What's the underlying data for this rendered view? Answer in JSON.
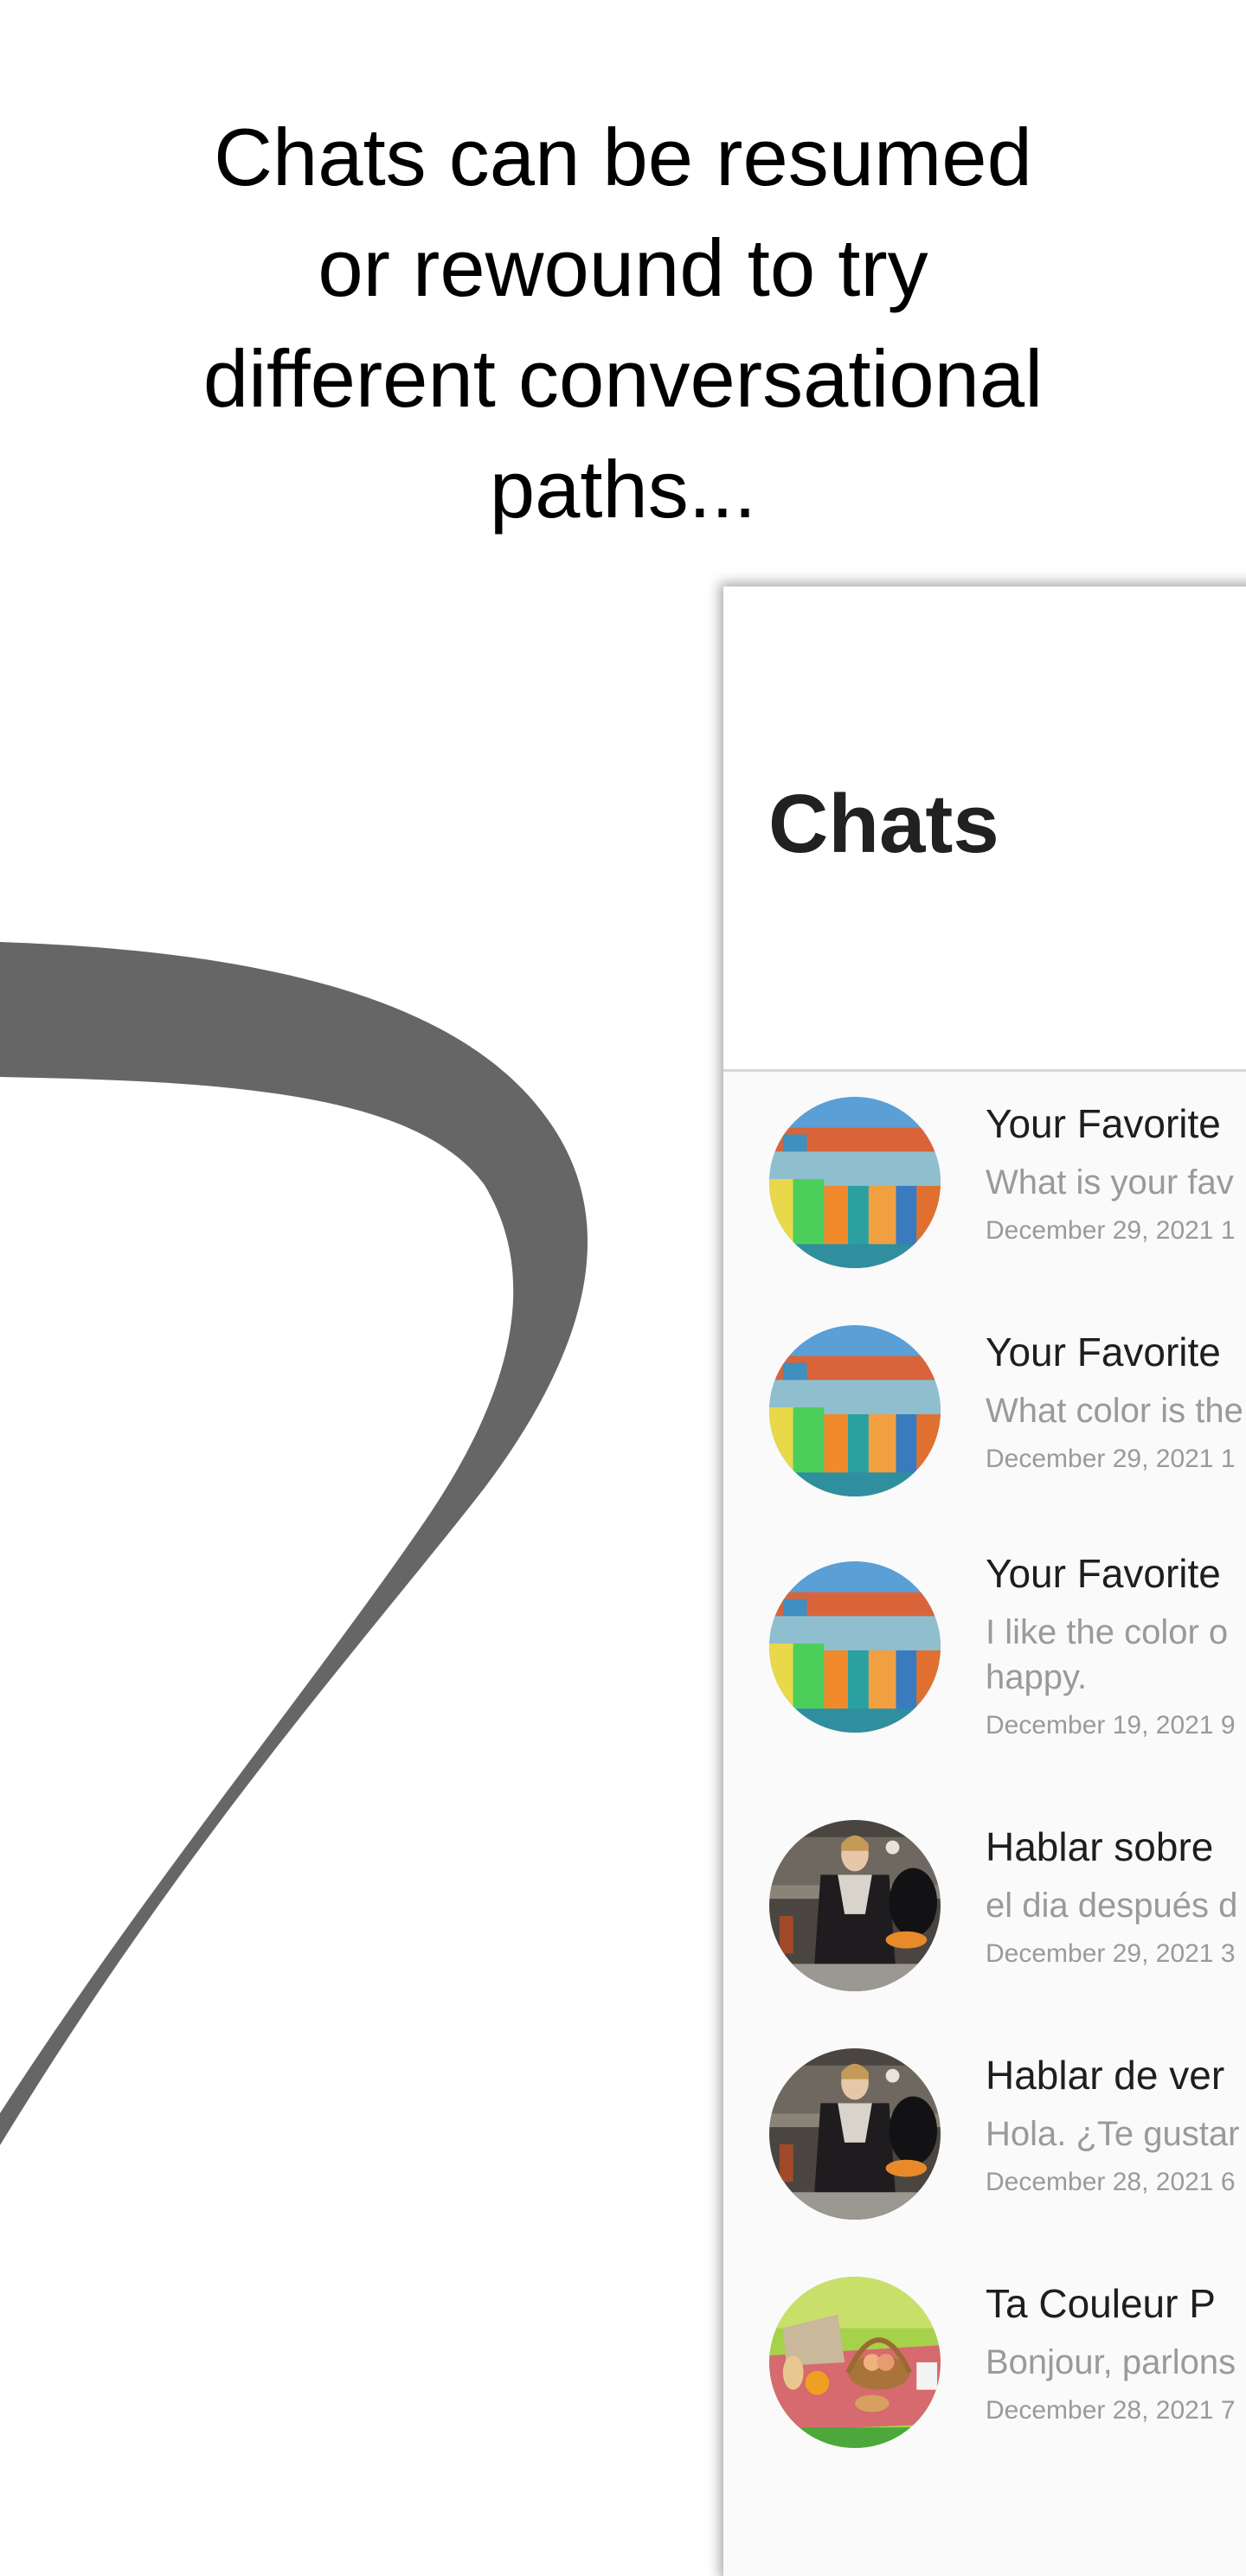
{
  "headline": {
    "lines": [
      "Chats can be resumed",
      "or rewound to try",
      "different conversational",
      "paths..."
    ]
  },
  "decoration": {
    "curve_color": "#666666"
  },
  "panel": {
    "title": "Chats",
    "chats": [
      {
        "avatar": "colorful-buildings-painting",
        "title": "Your Favorite",
        "subtitle": "What is your fav",
        "date": "December 29, 2021 1"
      },
      {
        "avatar": "colorful-buildings-painting",
        "title": "Your Favorite",
        "subtitle": "What color is the",
        "date": "December 29, 2021 1"
      },
      {
        "avatar": "colorful-buildings-painting",
        "title": "Your Favorite",
        "subtitle": "I like the color o happy.",
        "subtitle_lines": [
          "I like the color o",
          "happy."
        ],
        "date": "December 19, 2021 9"
      },
      {
        "avatar": "bar-maid-painting",
        "title": "Hablar sobre",
        "subtitle": "el dia después d",
        "date": "December 29, 2021 3"
      },
      {
        "avatar": "bar-maid-painting",
        "title": "Hablar de ver",
        "subtitle": "Hola. ¿Te gustar",
        "date": "December 28, 2021 6"
      },
      {
        "avatar": "picnic-basket-photo",
        "title": "Ta Couleur P",
        "subtitle": "Bonjour, parlons",
        "date": "December 28, 2021 7"
      }
    ]
  }
}
